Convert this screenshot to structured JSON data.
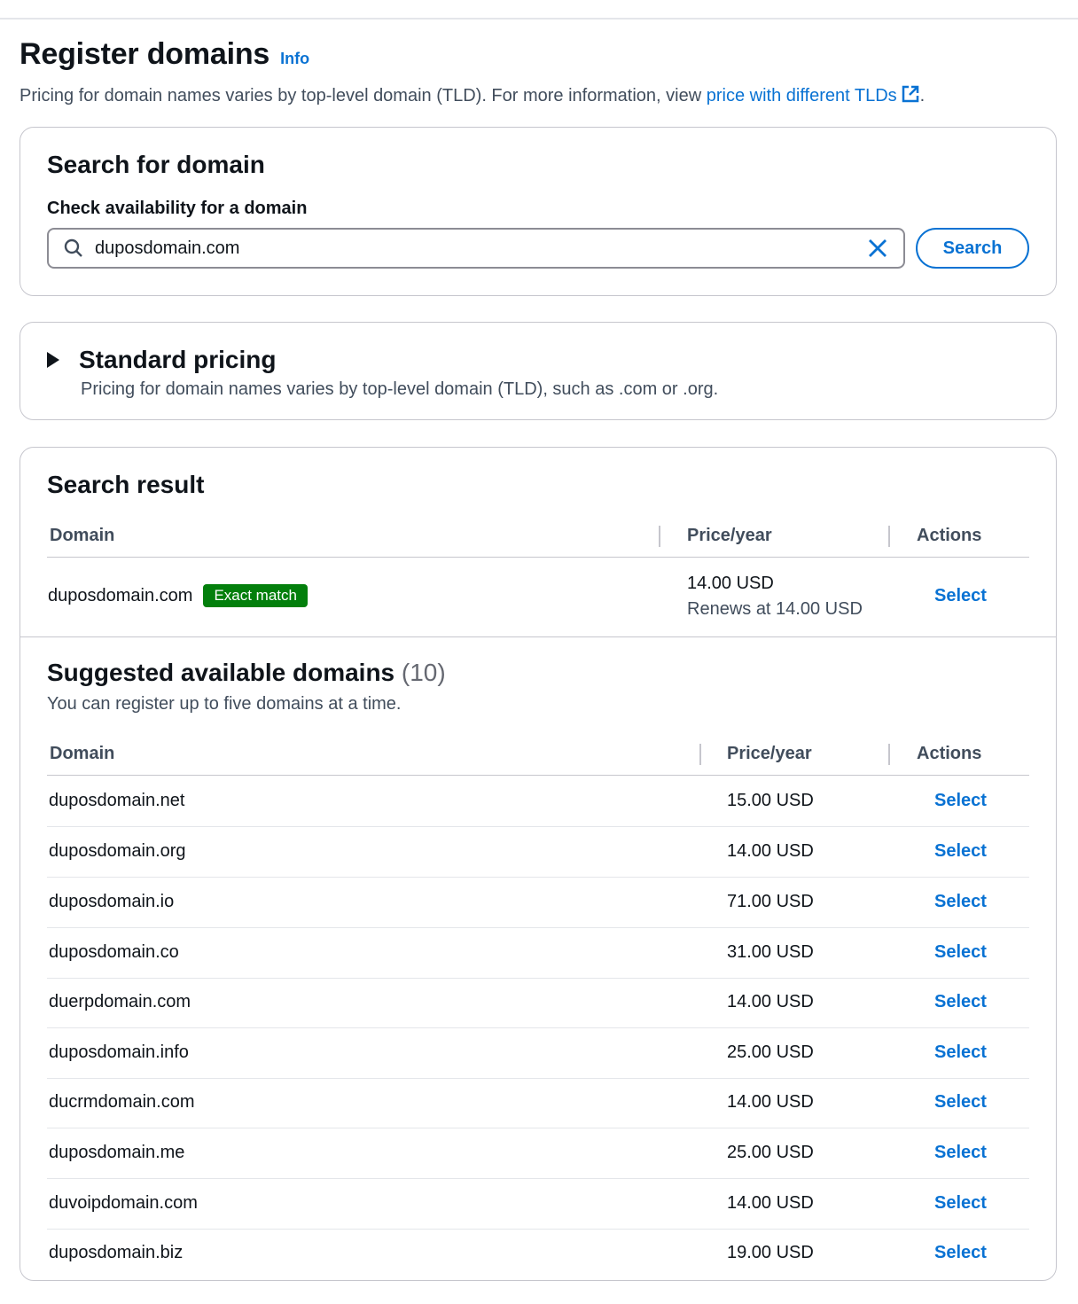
{
  "header": {
    "title": "Register domains",
    "info_label": "Info",
    "description_prefix": "Pricing for domain names varies by top-level domain (TLD). For more information, view ",
    "description_link": "price with different TLDs",
    "description_suffix": "."
  },
  "search": {
    "title": "Search for domain",
    "field_label": "Check availability for a domain",
    "value": "duposdomain.com",
    "button_label": "Search"
  },
  "pricing": {
    "title": "Standard pricing",
    "description": "Pricing for domain names varies by top-level domain (TLD), such as .com or .org."
  },
  "result": {
    "title": "Search result",
    "columns": {
      "domain": "Domain",
      "price": "Price/year",
      "actions": "Actions"
    },
    "domain": "duposdomain.com",
    "badge": "Exact match",
    "price": "14.00 USD",
    "renewal": "Renews at 14.00 USD",
    "action": "Select"
  },
  "suggested": {
    "title": "Suggested available domains",
    "count": "(10)",
    "description": "You can register up to five domains at a time.",
    "columns": {
      "domain": "Domain",
      "price": "Price/year",
      "actions": "Actions"
    },
    "rows": [
      {
        "domain": "duposdomain.net",
        "price": "15.00 USD",
        "action": "Select"
      },
      {
        "domain": "duposdomain.org",
        "price": "14.00 USD",
        "action": "Select"
      },
      {
        "domain": "duposdomain.io",
        "price": "71.00 USD",
        "action": "Select"
      },
      {
        "domain": "duposdomain.co",
        "price": "31.00 USD",
        "action": "Select"
      },
      {
        "domain": "duerpdomain.com",
        "price": "14.00 USD",
        "action": "Select"
      },
      {
        "domain": "duposdomain.info",
        "price": "25.00 USD",
        "action": "Select"
      },
      {
        "domain": "ducrmdomain.com",
        "price": "14.00 USD",
        "action": "Select"
      },
      {
        "domain": "duposdomain.me",
        "price": "25.00 USD",
        "action": "Select"
      },
      {
        "domain": "duvoipdomain.com",
        "price": "14.00 USD",
        "action": "Select"
      },
      {
        "domain": "duposdomain.biz",
        "price": "19.00 USD",
        "action": "Select"
      }
    ]
  },
  "colors": {
    "link": "#0972d3",
    "badge": "#037f0c",
    "border": "#c6c6cd",
    "text": "#0f141a",
    "muted": "#414d5c"
  },
  "icons": {
    "external": "external-link-icon",
    "search": "search-icon",
    "clear": "close-icon",
    "caret": "caret-right-icon"
  }
}
